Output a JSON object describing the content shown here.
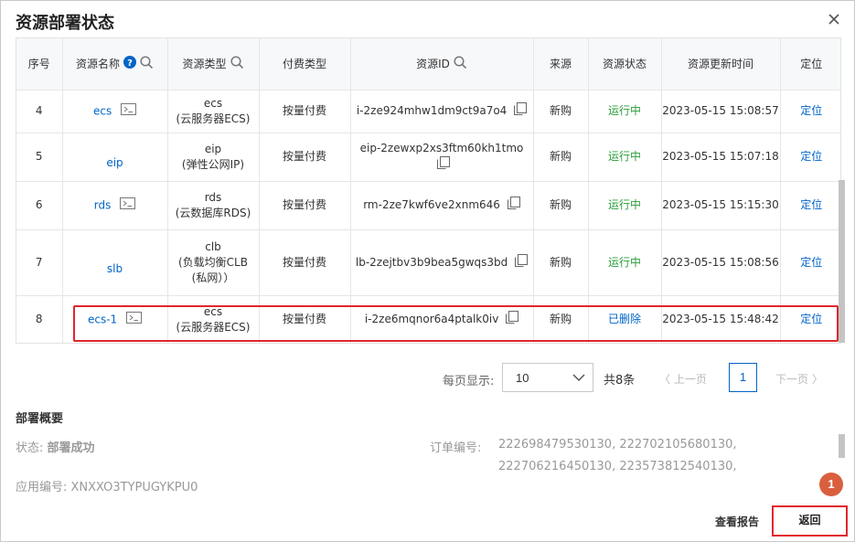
{
  "dialog": {
    "title": "资源部署状态",
    "close_icon": "close-icon"
  },
  "table": {
    "columns": [
      "序号",
      "资源名称",
      "资源类型",
      "付费类型",
      "资源ID",
      "来源",
      "资源状态",
      "资源更新时间",
      "定位"
    ],
    "rows": [
      {
        "no": "4",
        "name": "ecs",
        "type_line1": "ecs",
        "type_line2": "(云服务器ECS)",
        "type_line3": "",
        "pay": "按量付费",
        "id": "i-2ze924mhw1dm9ct9a7o4",
        "source": "新购",
        "status": "运行中",
        "time": "2023-05-15 15:08:57",
        "locate": "定位"
      },
      {
        "no": "5",
        "name": "eip",
        "type_line1": "eip",
        "type_line2": "(弹性公网IP)",
        "type_line3": "",
        "pay": "按量付费",
        "id": "eip-2zewxp2xs3ftm60kh1tmo",
        "source": "新购",
        "status": "运行中",
        "time": "2023-05-15 15:07:18",
        "locate": "定位"
      },
      {
        "no": "6",
        "name": "rds",
        "type_line1": "rds",
        "type_line2": "(云数据库RDS)",
        "type_line3": "",
        "pay": "按量付费",
        "id": "rm-2ze7kwf6ve2xnm646",
        "source": "新购",
        "status": "运行中",
        "time": "2023-05-15 15:15:30",
        "locate": "定位"
      },
      {
        "no": "7",
        "name": "slb",
        "type_line1": "clb",
        "type_line2": "(负载均衡CLB",
        "type_line3": "(私网））",
        "pay": "按量付费",
        "id": "lb-2zejtbv3b9bea5gwqs3bd",
        "source": "新购",
        "status": "运行中",
        "time": "2023-05-15 15:08:56",
        "locate": "定位"
      },
      {
        "no": "8",
        "name": "ecs-1",
        "type_line1": "ecs",
        "type_line2": "(云服务器ECS)",
        "type_line3": "",
        "pay": "按量付费",
        "id": "i-2ze6mqnor6a4ptalk0iv",
        "source": "新购",
        "status": "已删除",
        "time": "2023-05-15 15:48:42",
        "locate": "定位"
      }
    ]
  },
  "pager": {
    "page_size_label": "每页显示:",
    "page_size_value": "10",
    "total": "共8条",
    "prev": "上一页",
    "current": "1",
    "next": "下一页"
  },
  "summary": {
    "title": "部署概要",
    "status_label": "状态:",
    "status_value": "部署成功",
    "app_no": "应用编号: XNXXO3TYPUGYKPU0",
    "order_label": "订单编号:",
    "order_line1": "222698479530130, 222702105680130,",
    "order_line2": "222706216450130, 223573812540130,"
  },
  "footer": {
    "report": "查看报告",
    "back": "返回",
    "badge": "1"
  },
  "colors": {
    "link": "#0064c8",
    "running": "#2a9d3a",
    "highlight": "#e0262d",
    "badge": "#d95f3e"
  }
}
